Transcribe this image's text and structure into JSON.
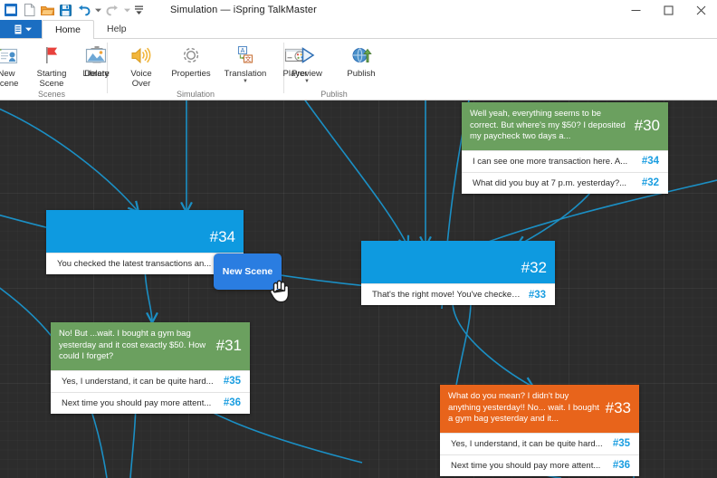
{
  "window": {
    "title": "Simulation — iSpring TalkMaster",
    "quick_access": [
      {
        "name": "app-icon",
        "icon": "app-icon"
      },
      {
        "name": "new-file",
        "icon": "new-document-icon"
      },
      {
        "name": "open-file",
        "icon": "open-folder-icon"
      },
      {
        "name": "save-file",
        "icon": "save-disk-icon"
      },
      {
        "name": "undo",
        "icon": "undo-arrow-icon"
      },
      {
        "name": "undo-dropdown",
        "icon": "chevron-down-icon"
      },
      {
        "name": "redo",
        "icon": "redo-arrow-icon"
      },
      {
        "name": "redo-dropdown",
        "icon": "chevron-down-icon"
      },
      {
        "name": "customize-qat",
        "icon": "customize-toolbar-icon"
      }
    ],
    "controls": {
      "minimize": "minimize-icon",
      "maximize": "maximize-icon",
      "close": "close-icon"
    }
  },
  "ribbon": {
    "file_menu_label": "",
    "tabs": [
      {
        "label": "Home",
        "active": true
      },
      {
        "label": "Help",
        "active": false
      }
    ],
    "groups": [
      {
        "name": "Scenes",
        "items": [
          {
            "label": "New\nScene",
            "label_line1": "New",
            "label_line2": "Scene",
            "icon": "new-scene-icon",
            "dropdown": false
          },
          {
            "label": "Starting\nScene",
            "label_line1": "Starting",
            "label_line2": "Scene",
            "icon": "starting-scene-flag-icon",
            "dropdown": false
          },
          {
            "label": "Delete",
            "label_line1": "Delete",
            "label_line2": "",
            "icon": "delete-trash-icon",
            "dropdown": false
          }
        ]
      },
      {
        "name": "Simulation",
        "items": [
          {
            "label": "Library",
            "label_line1": "Library",
            "label_line2": "",
            "icon": "library-picture-icon",
            "dropdown": false
          },
          {
            "label": "Voice\nOver",
            "label_line1": "Voice",
            "label_line2": "Over",
            "icon": "voice-over-speaker-icon",
            "dropdown": false
          },
          {
            "label": "Properties",
            "label_line1": "Properties",
            "label_line2": "",
            "icon": "properties-gear-icon",
            "dropdown": false
          },
          {
            "label": "Translation",
            "label_line1": "Translation",
            "label_line2": "",
            "icon": "translation-icon",
            "dropdown": true
          },
          {
            "label": "Player",
            "label_line1": "Player",
            "label_line2": "",
            "icon": "player-window-icon",
            "dropdown": false
          }
        ]
      },
      {
        "name": "Publish",
        "items": [
          {
            "label": "Preview",
            "label_line1": "Preview",
            "label_line2": "",
            "icon": "preview-play-icon",
            "dropdown": true
          },
          {
            "label": "Publish",
            "label_line1": "Publish",
            "label_line2": "",
            "icon": "publish-globe-icon",
            "dropdown": false
          }
        ]
      }
    ]
  },
  "canvas": {
    "background_color": "#2c2c2c",
    "edge_color": "#1b8fc4",
    "new_scene_bubble": {
      "label": "New Scene",
      "color": "#2a7de1"
    },
    "nodes": [
      {
        "id": "node-30",
        "number": "#30",
        "color": "#6ba05f",
        "type": "message",
        "text": "Well yeah, everything seems to be correct. But where's my $50? I deposited my paycheck two days a...",
        "replies": [
          {
            "text": "I can see one more transaction here. A...",
            "number": "#34"
          },
          {
            "text": "What did you buy at 7 p.m. yesterday?...",
            "number": "#32"
          }
        ]
      },
      {
        "id": "node-34",
        "number": "#34",
        "color": "#0e9ae0",
        "type": "scene",
        "text": "",
        "replies": [
          {
            "text": "You checked the latest transactions an...",
            "number": ""
          }
        ]
      },
      {
        "id": "node-31",
        "number": "#31",
        "color": "#6ba05f",
        "type": "message",
        "text": "No! But ...wait. I bought a gym bag yesterday and it cost exactly $50. How could I forget?",
        "replies": [
          {
            "text": "Yes,  I understand, it can be quite hard...",
            "number": "#35"
          },
          {
            "text": "Next time you should pay more attent...",
            "number": "#36"
          }
        ]
      },
      {
        "id": "node-32",
        "number": "#32",
        "color": "#0e9ae0",
        "type": "scene",
        "text": "",
        "replies": [
          {
            "text": "That's the right move! You've checked...",
            "number": "#33"
          }
        ]
      },
      {
        "id": "node-33",
        "number": "#33",
        "color": "#e8641b",
        "type": "message",
        "text": "What do you mean? I didn't buy anything yesterday!! No... wait. I bought a gym bag yesterday and it...",
        "replies": [
          {
            "text": "Yes, I understand, it can be quite hard...",
            "number": "#35"
          },
          {
            "text": "Next time you should pay more attent...",
            "number": "#36"
          }
        ]
      }
    ]
  }
}
